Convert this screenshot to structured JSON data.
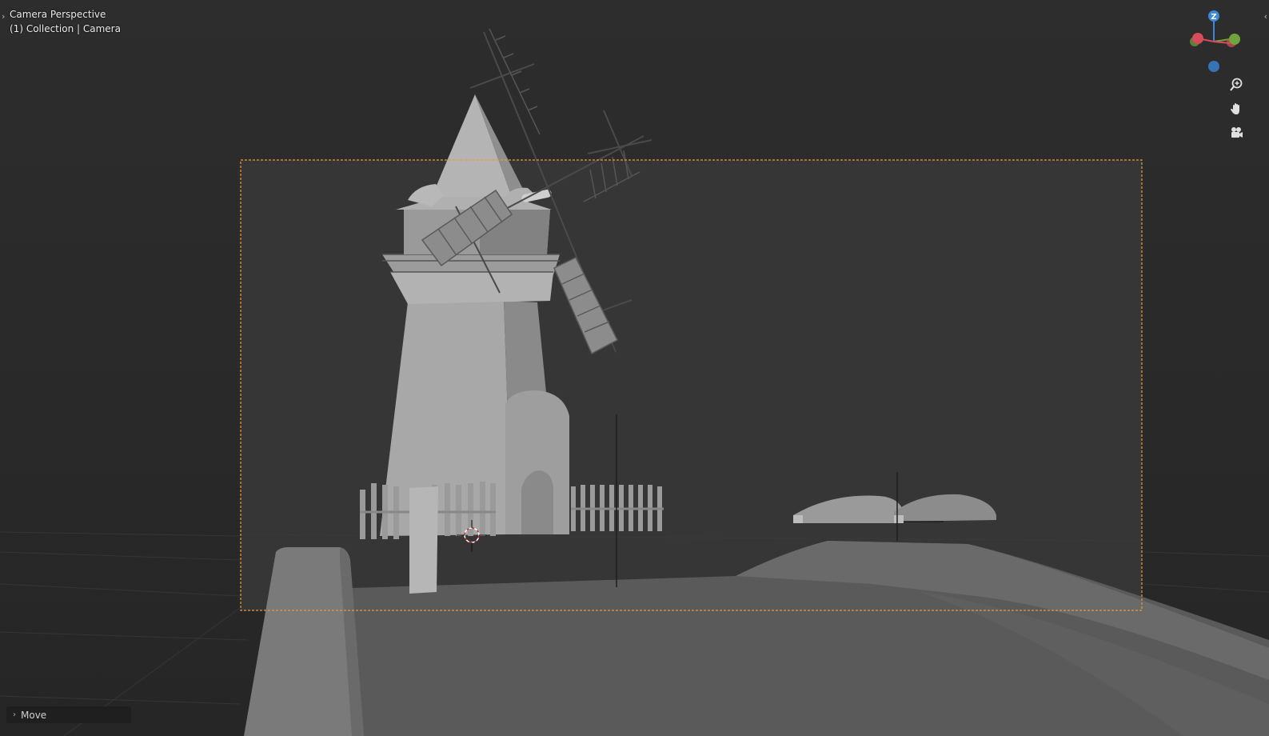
{
  "viewport": {
    "view_name": "Camera Perspective",
    "collection_line": "(1) Collection | Camera",
    "left_toggle": "›",
    "right_toggle": "‹"
  },
  "gizmo": {
    "z_label": "Z",
    "colors": {
      "x_axis": "#d84b5a",
      "y_axis": "#6fa53b",
      "z_axis": "#3b87d8"
    }
  },
  "nav_buttons": [
    {
      "icon": "zoom-icon"
    },
    {
      "icon": "pan-hand-icon"
    },
    {
      "icon": "camera-view-icon"
    }
  ],
  "operator_panel": {
    "chevron": "›",
    "label": "Move"
  },
  "colors": {
    "background": "#2b2b2b",
    "camera_frame": "#e89a3c",
    "model_light": "#a6a6a6",
    "model_dark": "#5f5f5f",
    "cursor_red": "#c83030"
  }
}
